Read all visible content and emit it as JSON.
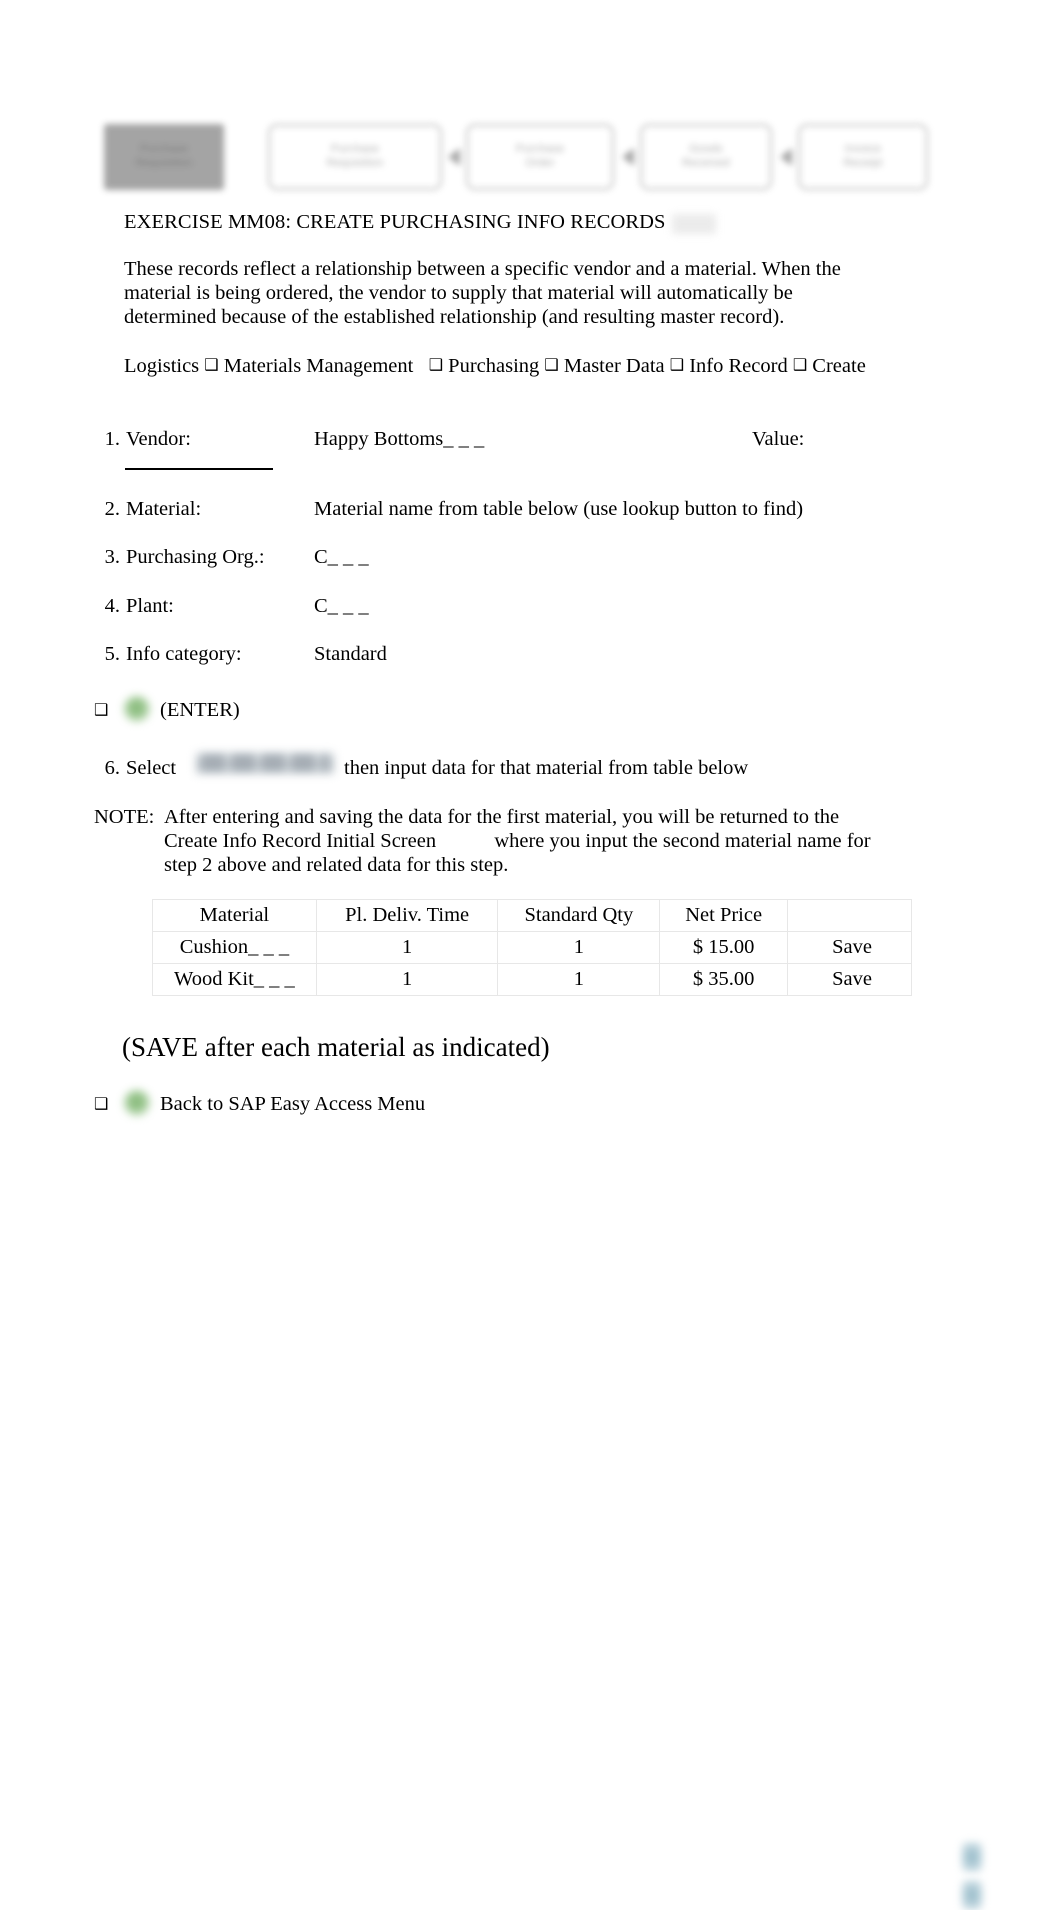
{
  "document": {
    "title": "EXERCISE MM08: CREATE PURCHASING INFO RECORDS",
    "intro": "These records reflect a relationship between a specific vendor and a material. When the material is being ordered, the vendor to supply that material will automatically be determined because of the established relationship (and resulting master record).",
    "save_note": "(SAVE after each material as indicated)"
  },
  "banner": {
    "boxes": [
      {
        "line1": "Purchase",
        "line2": "Requisition",
        "filled": true
      },
      {
        "line1": "Purchase",
        "line2": "Requisition",
        "filled": false
      },
      {
        "line1": "Purchase",
        "line2": "Order",
        "filled": false
      },
      {
        "line1": "Goods",
        "line2": "Received",
        "filled": false
      },
      {
        "line1": "Invoice",
        "line2": "Receipt",
        "filled": false
      }
    ]
  },
  "nav_path": {
    "separator": "❑",
    "items": [
      "Logistics",
      "Materials Management",
      "Purchasing",
      "Master Data",
      "Info Record",
      "Create"
    ]
  },
  "steps": [
    {
      "num": "1.",
      "label": "Vendor:",
      "value": "Happy Bottoms_ _ _",
      "value2": "Value:"
    },
    {
      "num": "2.",
      "label": "Material:",
      "value": "Material name from table below (use lookup button to find)",
      "value2": ""
    },
    {
      "num": "3.",
      "label": "Purchasing Org.:",
      "value": "C_ _ _",
      "value2": ""
    },
    {
      "num": "4.",
      "label": "Plant:",
      "value": "C_ _ _",
      "value2": ""
    },
    {
      "num": "5.",
      "label": "Info category:",
      "value": "Standard",
      "value2": ""
    }
  ],
  "enter_row": {
    "bullet": "❑",
    "icon": "sap-enter-icon",
    "text": "(ENTER)"
  },
  "step6": {
    "num": "6.",
    "prefix": "Select",
    "button_label": "",
    "suffix": "then input data for that material from table below"
  },
  "note": {
    "tag": "NOTE:",
    "line1": "After entering and saving the data for the first material, you will be returned to the",
    "line2": "Create Info Record Initial Screen",
    "line2b": "where you input the second material name for",
    "line3": "step 2 above and related data for this step."
  },
  "table": {
    "headers": [
      "Material",
      "Pl. Deliv. Time",
      "Standard Qty",
      "Net Price",
      ""
    ],
    "rows": [
      {
        "material": "Cushion_ _ _",
        "deliv": "1",
        "qty": "1",
        "price": "$ 15.00",
        "save": "Save"
      },
      {
        "material": "Wood Kit_ _ _",
        "deliv": "1",
        "qty": "1",
        "price": "$ 35.00",
        "save": "Save"
      }
    ]
  },
  "back_row": {
    "bullet": "❑",
    "icon": "sap-back-icon",
    "text": "Back to SAP Easy Access Menu"
  },
  "colors": {
    "enter_icon_green": "#8bbe7f",
    "save_icon_blue": "#a8c9d6",
    "banner_outline": "#b8b8b8",
    "banner_fill": "#9d9d9d",
    "table_border": "#e7e7e7"
  }
}
